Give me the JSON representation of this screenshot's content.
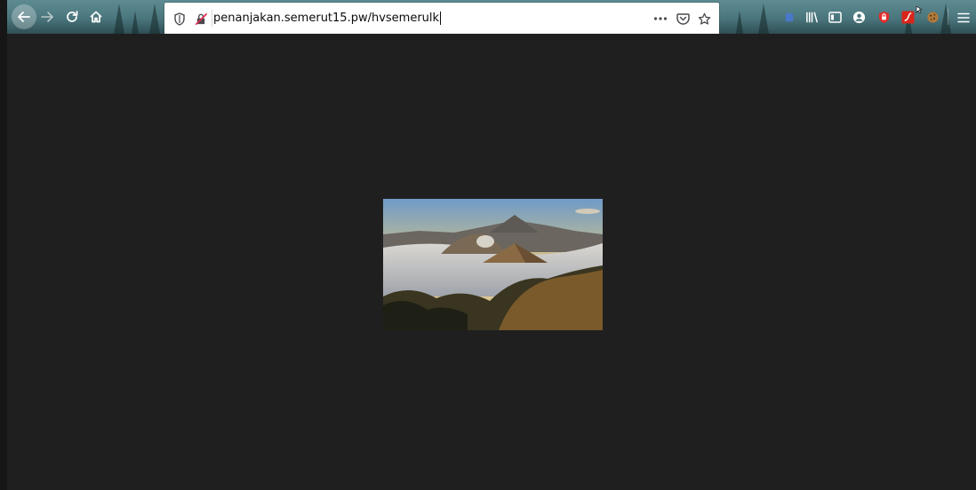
{
  "toolbar": {
    "url": "penanjakan.semerut15.pw/hvsemerulk"
  },
  "icons": {
    "back": "back-arrow-icon",
    "forward": "forward-arrow-icon",
    "reload": "reload-icon",
    "home": "home-icon",
    "tracking": "shield-icon",
    "insecure": "insecure-connection-icon",
    "more": "more-actions-icon",
    "pocket": "pocket-icon",
    "bookmark": "star-icon",
    "library": "library-icon",
    "sidebar": "sidebar-icon",
    "account": "account-icon",
    "menu": "hamburger-menu-icon"
  },
  "colors": {
    "page_background": "#201f20",
    "toolbar_theme": "#4a757c",
    "urlbar_background": "#ffffff"
  },
  "content": {
    "image_subject": "volcano landscape above clouds"
  }
}
